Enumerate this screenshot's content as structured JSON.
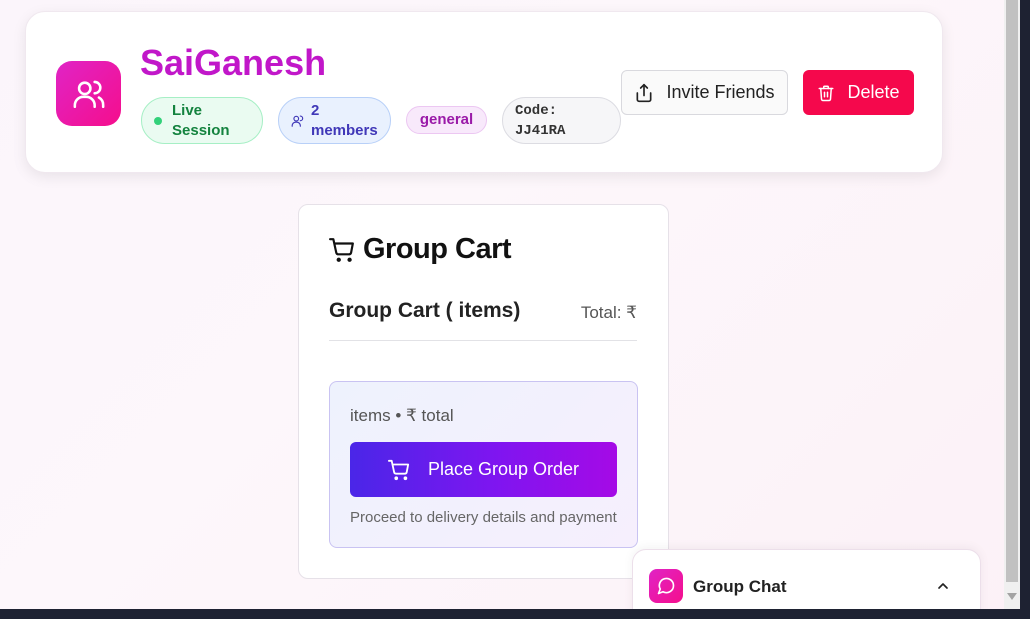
{
  "header": {
    "group_name": "SaiGanesh",
    "live_label": "Live Session",
    "members_label": "2 members",
    "category_label": "general",
    "code_label": "Code: JJ41RA",
    "invite_label": "Invite Friends",
    "delete_label": "Delete"
  },
  "cart": {
    "heading": "Group Cart",
    "subheading": "Group Cart ( items)",
    "total_label": "Total: ₹",
    "summary": "items • ₹ total",
    "order_button_label": "Place Group Order",
    "order_note": "Proceed to delivery details and payment"
  },
  "chat": {
    "title": "Group Chat"
  },
  "colors": {
    "brand": "#c117c9",
    "delete": "#f5084c",
    "order_gradient_start": "#4a26e8",
    "order_gradient_end": "#a50ae6"
  },
  "icons": [
    "users-icon",
    "share-icon",
    "trash-icon",
    "shopping-cart-icon",
    "chat-bubble-icon",
    "chevron-up-icon"
  ]
}
